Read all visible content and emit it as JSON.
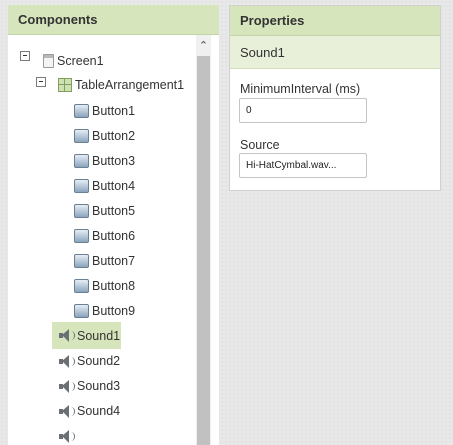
{
  "components_panel": {
    "title": "Components",
    "tree": {
      "screen": "Screen1",
      "table": "TableArrangement1",
      "buttons": [
        "Button1",
        "Button2",
        "Button3",
        "Button4",
        "Button5",
        "Button6",
        "Button7",
        "Button8",
        "Button9"
      ],
      "sounds": [
        "Sound1",
        "Sound2",
        "Sound3",
        "Sound4"
      ],
      "selected": "Sound1"
    },
    "scroll_up_icon": "chevron-up-icon"
  },
  "properties_panel": {
    "title": "Properties",
    "component_name": "Sound1",
    "fields": [
      {
        "label": "MinimumInterval (ms)",
        "value": "0"
      },
      {
        "label": "Source",
        "value": "Hi-HatCymbal.wav..."
      }
    ]
  }
}
